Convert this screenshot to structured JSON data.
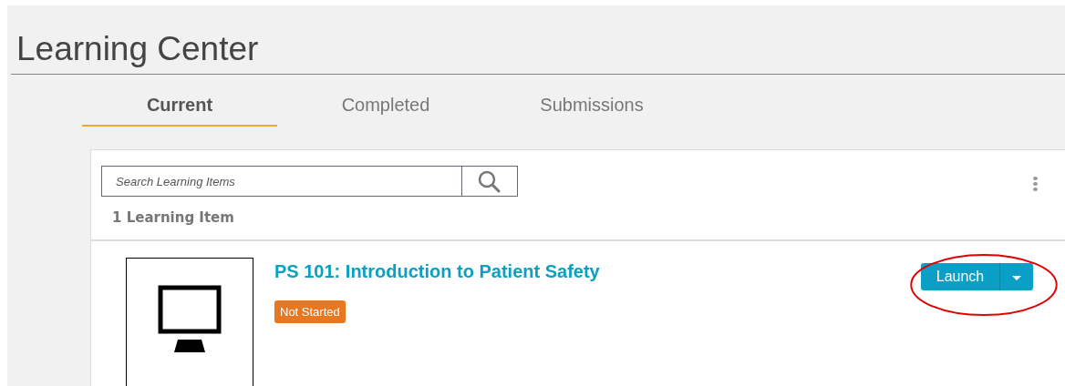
{
  "page_title": "Learning Center",
  "tabs": [
    {
      "label": "Current",
      "selected": true
    },
    {
      "label": "Completed",
      "selected": false
    },
    {
      "label": "Submissions",
      "selected": false
    }
  ],
  "search": {
    "placeholder": "Search Learning Items"
  },
  "item_count": "1 Learning Item",
  "items": [
    {
      "title": "PS 101: Introduction to Patient Safety",
      "status": "Not Started",
      "launch_label": "Launch",
      "highlighted": true
    }
  ]
}
